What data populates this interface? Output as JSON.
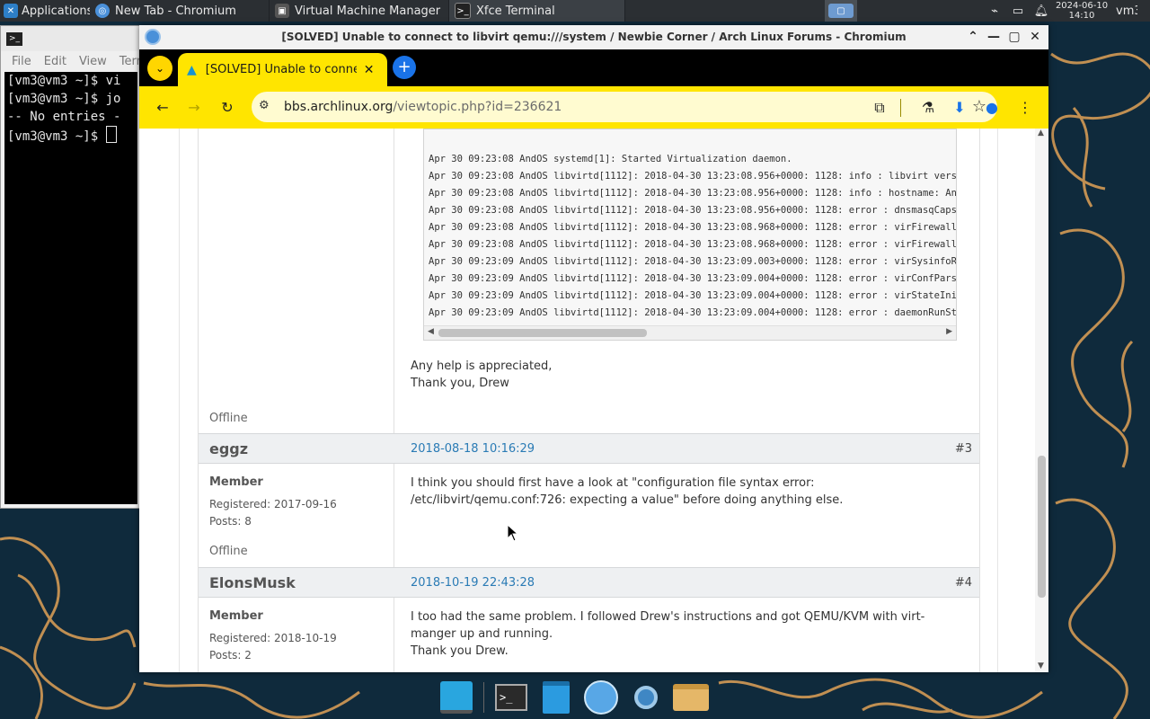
{
  "top_panel": {
    "applications_label": "Applications",
    "tasks": [
      {
        "label": "New Tab - Chromium",
        "icon": "chromium-icon"
      },
      {
        "label": "Virtual Machine Manager",
        "icon": "vm-manager-icon"
      },
      {
        "label": "Xfce Terminal",
        "icon": "terminal-icon"
      }
    ],
    "clock_date": "2024-06-10",
    "clock_time": "14:10",
    "user": "vm3"
  },
  "terminal": {
    "menu": [
      "File",
      "Edit",
      "View",
      "Terr"
    ],
    "lines": [
      "[vm3@vm3 ~]$ vi",
      "[vm3@vm3 ~]$ jo",
      "-- No entries -",
      "[vm3@vm3 ~]$ "
    ]
  },
  "browser": {
    "window_title": "[SOLVED] Unable to connect to libvirt qemu:///system / Newbie Corner / Arch Linux Forums - Chromium",
    "tab_title": "[SOLVED] Unable to connect to libvirt qemu:///system",
    "url_host": "bbs.archlinux.org",
    "url_path": "/viewtopic.php?id=236621",
    "colors": {
      "toolbar": "#ffe500",
      "link": "#2a7bb5"
    }
  },
  "code_lines": [
    "Apr 30 09:23:08 AndOS systemd[1]: Started Virtualization daemon.",
    "Apr 30 09:23:08 AndOS libvirtd[1112]: 2018-04-30 13:23:08.956+0000: 1128: info : libvirt versi",
    "Apr 30 09:23:08 AndOS libvirtd[1112]: 2018-04-30 13:23:08.956+0000: 1128: info : hostname: And",
    "Apr 30 09:23:08 AndOS libvirtd[1112]: 2018-04-30 13:23:08.956+0000: 1128: error : dnsmasqCaps",
    "Apr 30 09:23:08 AndOS libvirtd[1112]: 2018-04-30 13:23:08.968+0000: 1128: error : virFirewall",
    "Apr 30 09:23:08 AndOS libvirtd[1112]: 2018-04-30 13:23:08.968+0000: 1128: error : virFirewall",
    "Apr 30 09:23:09 AndOS libvirtd[1112]: 2018-04-30 13:23:09.003+0000: 1128: error : virSysinfoR",
    "Apr 30 09:23:09 AndOS libvirtd[1112]: 2018-04-30 13:23:09.004+0000: 1128: error : virConfPars",
    "Apr 30 09:23:09 AndOS libvirtd[1112]: 2018-04-30 13:23:09.004+0000: 1128: error : virStateIni",
    "Apr 30 09:23:09 AndOS libvirtd[1112]: 2018-04-30 13:23:09.004+0000: 1128: error : daemonRunSt"
  ],
  "post2": {
    "text_line1": "Any help is appreciated,",
    "text_line2": "Thank you, Drew",
    "status": "Offline"
  },
  "post3": {
    "author": "eggz",
    "date": "2018-08-18 10:16:29",
    "number": "#3",
    "rank": "Member",
    "registered": "Registered: 2017-09-16",
    "posts": "Posts: 8",
    "status": "Offline",
    "text": "I think you should first have a look at \"configuration file syntax error: /etc/libvirt/qemu.conf:726: expecting a value\" before doing anything else."
  },
  "post4": {
    "author": "ElonsMusk",
    "date": "2018-10-19 22:43:28",
    "number": "#4",
    "rank": "Member",
    "registered": "Registered: 2018-10-19",
    "posts": "Posts: 2",
    "text_line1": "I too had the same problem. I followed Drew's instructions and got QEMU/KVM with virt-manger up and running.",
    "text_line2": "Thank you Drew."
  },
  "dock": [
    "workspace-icon",
    "terminal-icon",
    "files-icon",
    "web-browser-icon",
    "search-icon",
    "folder-icon"
  ]
}
